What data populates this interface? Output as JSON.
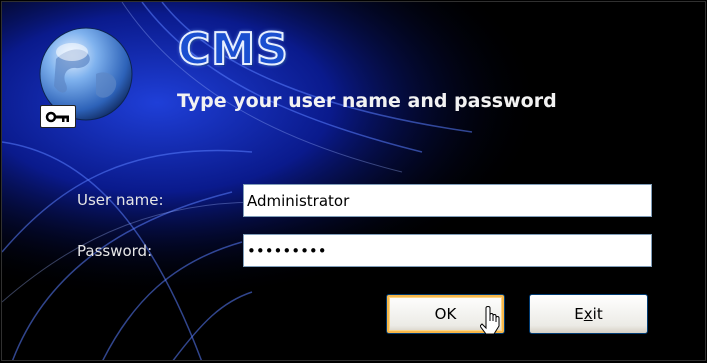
{
  "branding": {
    "logo_text": "CMS"
  },
  "dialog": {
    "instruction": "Type your user name and password"
  },
  "form": {
    "username_label": "User name:",
    "username_value": "Administrator",
    "password_label": "Password:",
    "password_value": "•••••••••"
  },
  "buttons": {
    "ok_label": "OK",
    "exit_label_prefix": "E",
    "exit_label_mnemonic": "x",
    "exit_label_suffix": "it"
  },
  "icons": {
    "globe": "globe-icon",
    "key": "key-icon",
    "cursor": "mouse-pointer-icon"
  },
  "colors": {
    "background": "#000000",
    "accent_blue": "#1a4fd0",
    "field_border": "#7f9db9",
    "default_button_highlight": "#f8b84b"
  }
}
